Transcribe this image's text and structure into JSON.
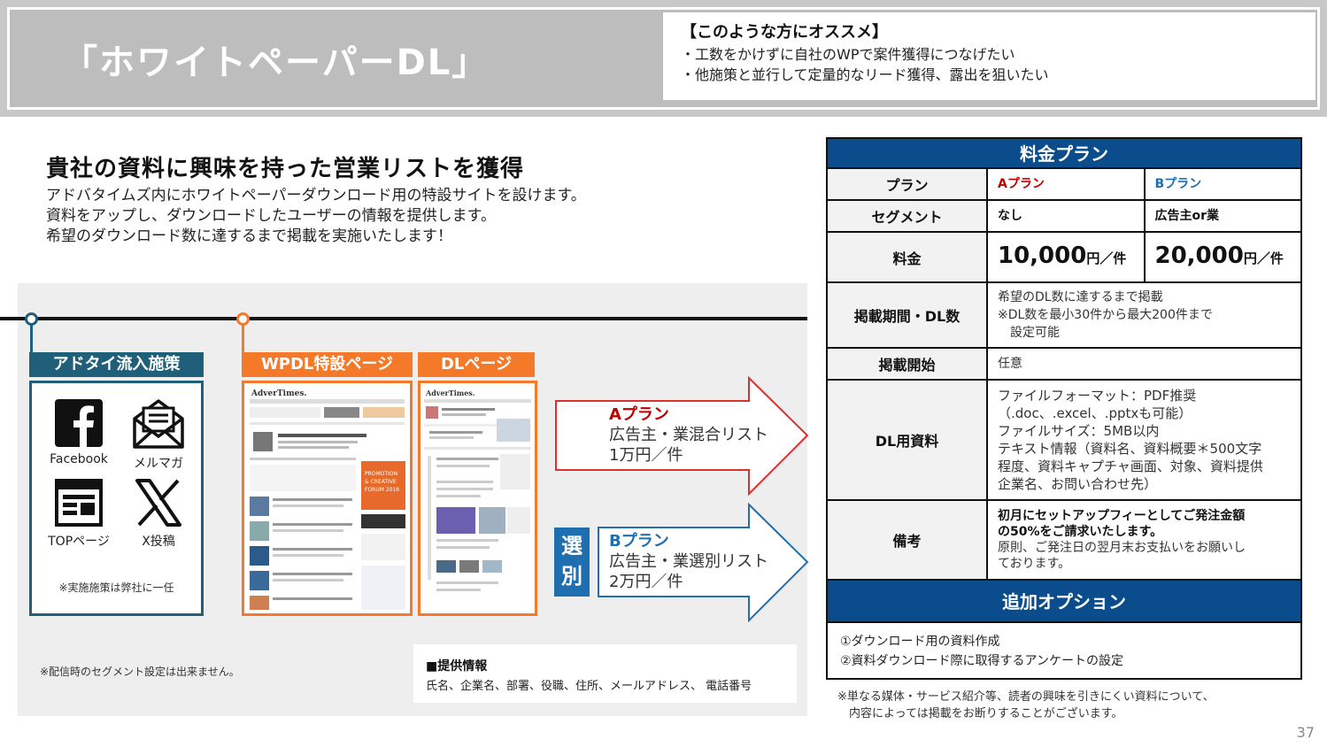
{
  "header": {
    "title": "「ホワイトペーパーDL」",
    "box_title": "【このような方にオススメ】",
    "box_lines": [
      "・工数をかけずに自社のWPで案件獲得につなげたい",
      "・他施策と並行して定量的なリード獲得、露出を狙いたい"
    ]
  },
  "intro": {
    "heading": "貴社の資料に興味を持った営業リストを獲得",
    "lines": [
      "アドバタイムズ内にホワイトペーパーダウンロード用の特設サイトを設けます。",
      "資料をアップし、ダウンロードしたユーザーの情報を提供します。",
      "希望のダウンロード数に達するまで掲載を実施いたします！"
    ]
  },
  "flow": {
    "channel_tag": "アドタイ流入施策",
    "wpdl_tag": "WPDL特設ページ",
    "dl_tag": "DLページ",
    "channels": [
      {
        "label": "Facebook",
        "icon": "facebook-icon"
      },
      {
        "label": "メルマガ",
        "icon": "mail-icon"
      },
      {
        "label": "TOPページ",
        "icon": "top-page-icon"
      },
      {
        "label": "X投稿",
        "icon": "x-icon"
      }
    ],
    "channel_note": "※実施施策は弊社に一任",
    "plan_a": {
      "name": "Aプラン",
      "desc": "広告主・業混合リスト",
      "price": "1万円／件"
    },
    "plan_b": {
      "name": "Bプラン",
      "desc": "広告主・業選別リスト",
      "price": "2万円／件"
    },
    "select_label": [
      "選",
      "別"
    ],
    "segment_note": "※配信時のセグメント設定は出来ません。",
    "info_title": "■提供情報",
    "info_text": "氏名、企業名、部署、役職、住所、メールアドレス、 電話番号"
  },
  "price_table": {
    "title": "料金プラン",
    "plan_label": "プラン",
    "plan_a": "Aプラン",
    "plan_b": "Bプラン",
    "segment_label": "セグメント",
    "segment_a": "なし",
    "segment_b": "広告主or業",
    "fee_label": "料金",
    "fee_a": "10,000",
    "fee_b": "20,000",
    "fee_unit": "円／件",
    "period_label": "掲載期間・DL数",
    "period_lines": [
      "希望のDL数に達するまで掲載",
      "※DL数を最小30件から最大200件まで",
      "　設定可能"
    ],
    "start_label": "掲載開始",
    "start_value": "任意",
    "material_label": "DL用資料",
    "material_lines": [
      "ファイルフォーマット：PDF推奨",
      "（.doc、.excel、.pptxも可能）",
      "ファイルサイズ：5MB以内",
      "テキスト情報（資料名、資料概要＊500文字",
      "程度、資料キャプチャ画面、対象、資料提供",
      "企業名、お問い合わせ先）"
    ],
    "remarks_label": "備考",
    "remarks_bold": [
      "初月にセットアップフィーとしてご発注金額",
      "の50%をご請求いたします。"
    ],
    "remarks_lines": [
      "原則、ご発注日の翌月末お支払いをお願いし",
      "ております。"
    ],
    "options_title": "追加オプション",
    "options": [
      "①ダウンロード用の資料作成",
      "②資料ダウンロード際に取得するアンケートの設定"
    ]
  },
  "footnote": [
    "※単なる媒体・サービス紹介等、読者の興味を引きにくい資料について、",
    "　内容によっては掲載をお断りすることがございます。"
  ],
  "page_number": "37",
  "colors": {
    "accent_navy": "#0b4d8c",
    "teal": "#1f5f7a",
    "orange": "#f47a2a",
    "red": "#c00000",
    "blue": "#1f6fb0"
  }
}
